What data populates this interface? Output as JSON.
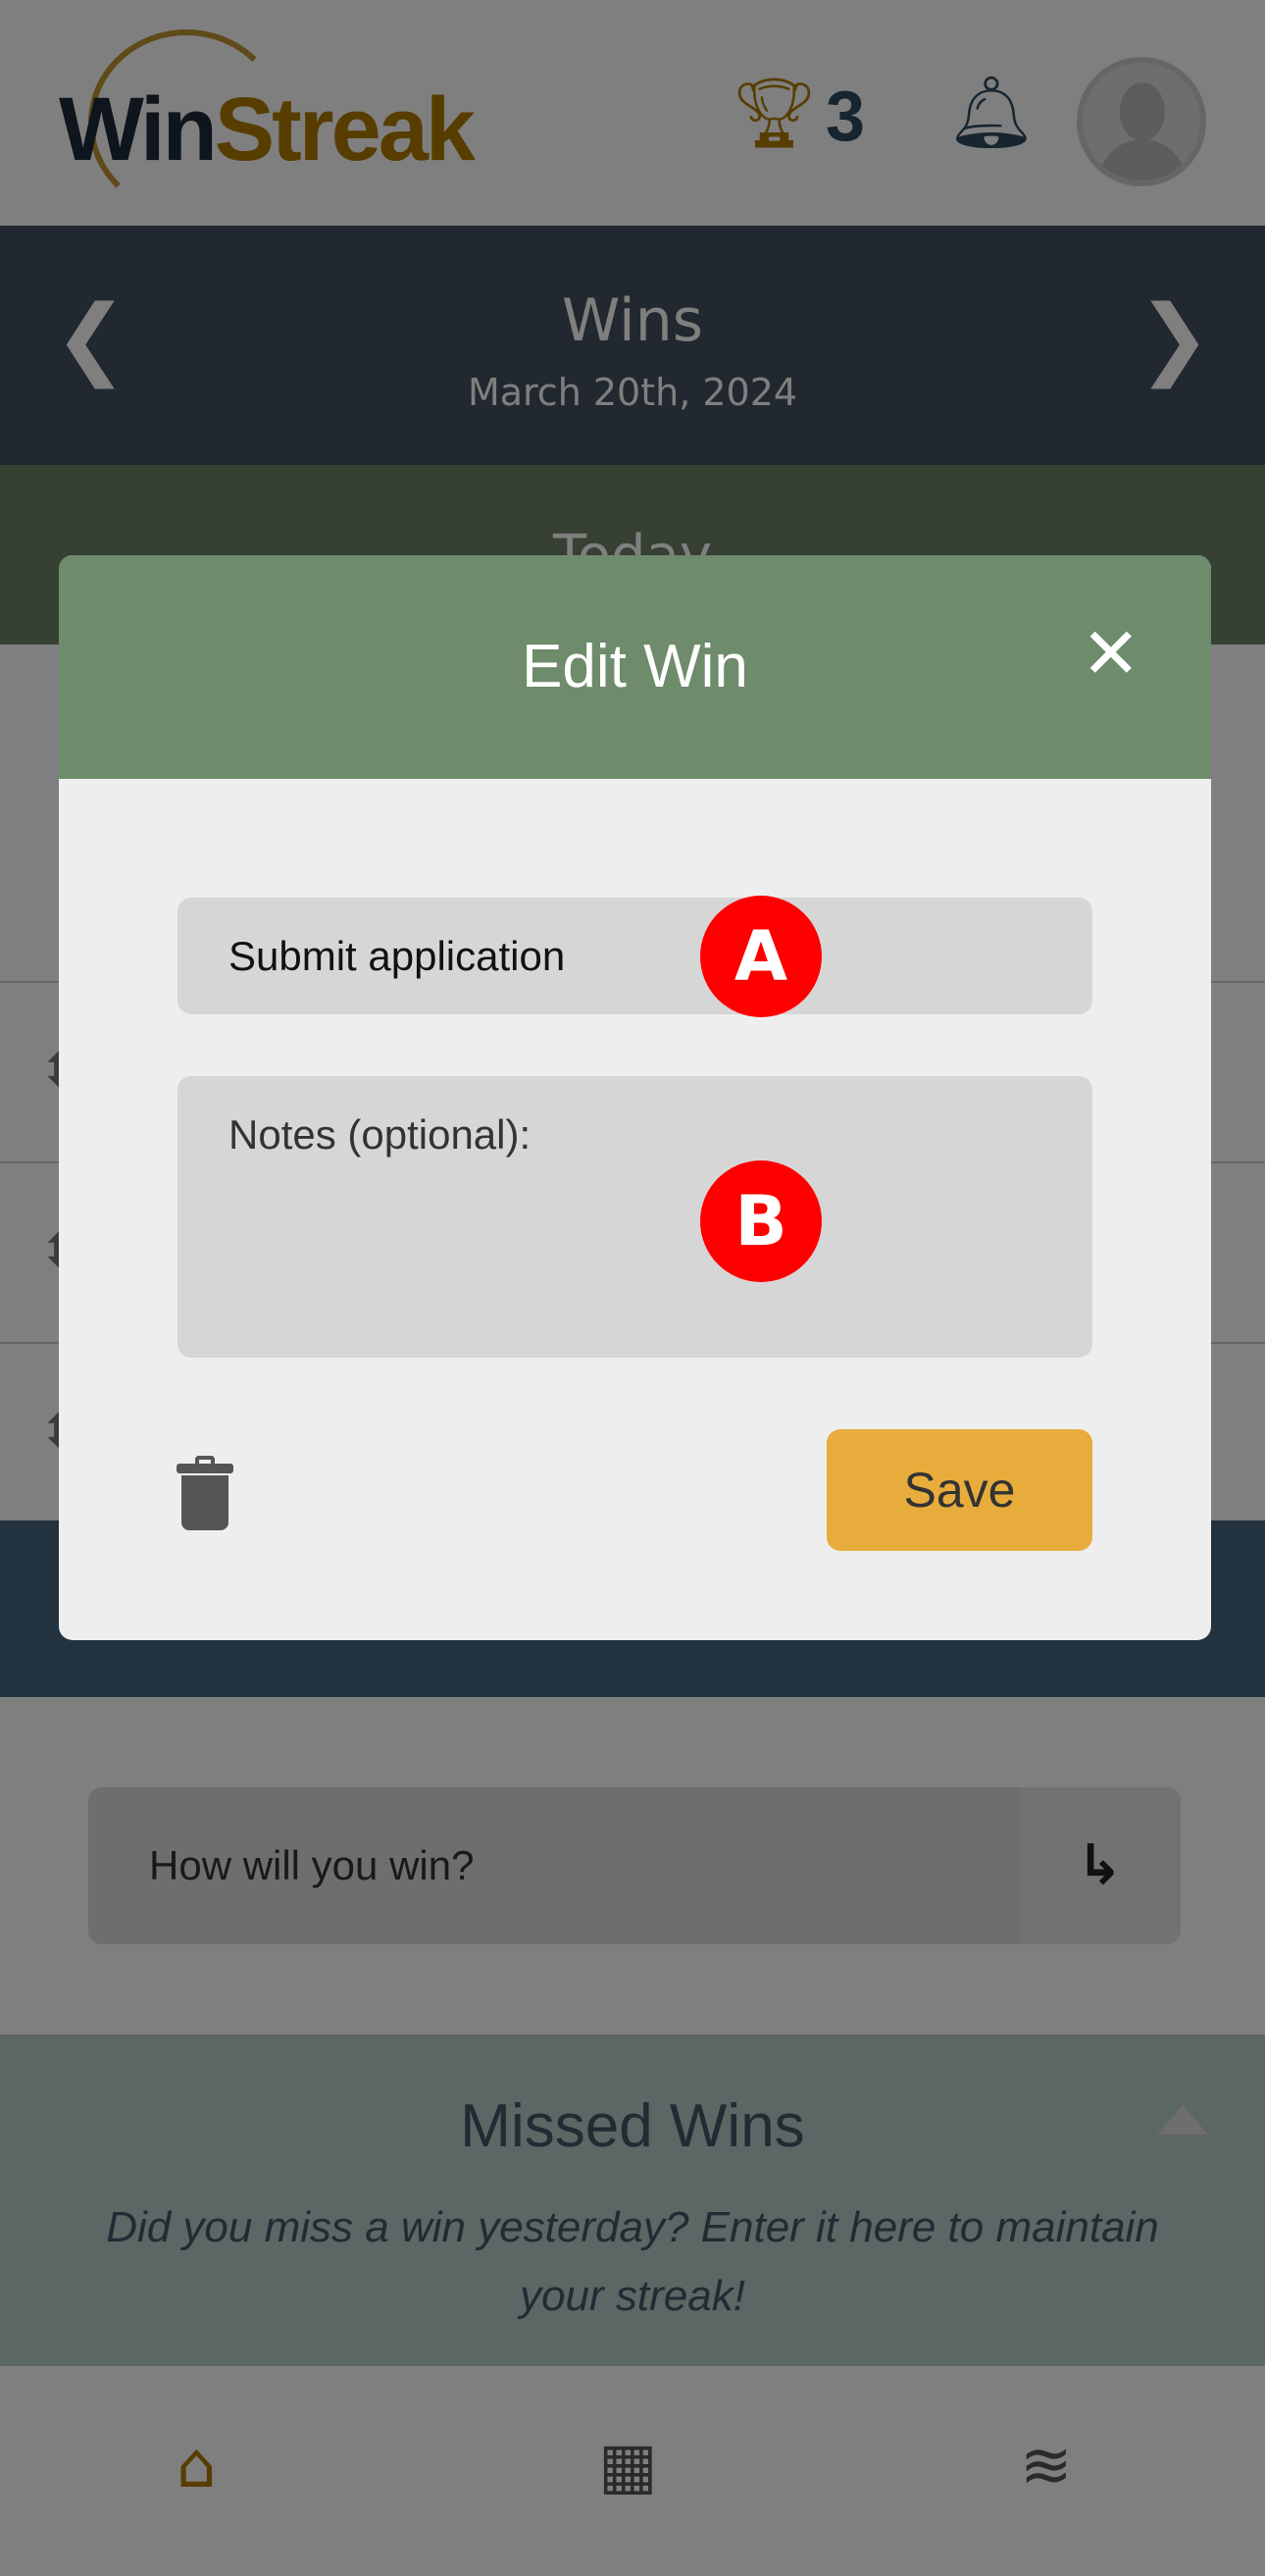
{
  "app": {
    "logo_text_a": "Win",
    "logo_text_b": "Streak",
    "trophy_count": "3",
    "brand_color": "#b07a00"
  },
  "date_nav": {
    "title": "Wins",
    "date": "March 20th, 2024",
    "prev": "❮",
    "next": "❯"
  },
  "today_section": {
    "title": "Today"
  },
  "entry": {
    "placeholder": "How will you win?",
    "submit_icon": "↳"
  },
  "missed": {
    "title": "Missed Wins",
    "text": "Did you miss a win yesterday? Enter it here to maintain your streak!"
  },
  "modal": {
    "title": "Edit Win",
    "close": "✕",
    "win_value": "Submit application",
    "notes_placeholder": "Notes (optional):",
    "save_label": "Save",
    "header_color": "#6e8b6b",
    "save_color": "#e8ac3c"
  },
  "annotations": {
    "a": "A",
    "b": "B"
  },
  "bottom_nav": {
    "home": "⌂",
    "calendar": "▦",
    "layers": "≋"
  }
}
